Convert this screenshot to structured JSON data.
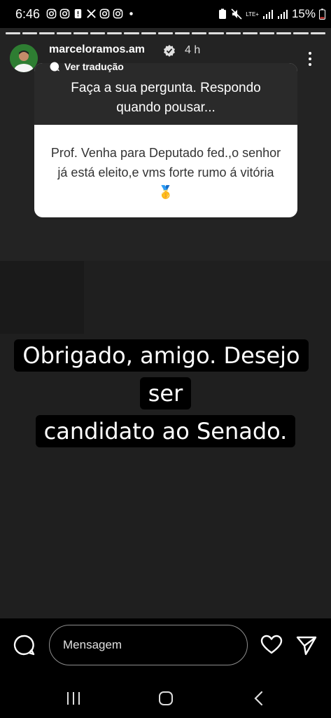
{
  "status_bar": {
    "time": "6:46",
    "battery": "15%",
    "network": "LTE+"
  },
  "story": {
    "segments": 19,
    "username": "marceloramos.am",
    "time_ago": "4 h",
    "translate_label": "Ver tradução"
  },
  "question_sticker": {
    "prompt": "Faça a sua pergunta. Respondo quando pousar...",
    "answer": "Prof. Venha para Deputado fed.,o senhor já está eleito,e vms forte rumo á vitória 🥇"
  },
  "reply": {
    "line1": "Obrigado, amigo. Desejo ser",
    "line2": "candidato ao Senado."
  },
  "bottom_bar": {
    "message_placeholder": "Mensagem"
  },
  "colors": {
    "background": "#1f1f1f",
    "card_dark": "#2a2a2a",
    "card_light": "#ffffff",
    "avatar_bg": "#2e7d32"
  },
  "icons": [
    "camera-icon",
    "heart-icon",
    "send-icon",
    "verified-icon",
    "more-icon",
    "translate-icon"
  ]
}
